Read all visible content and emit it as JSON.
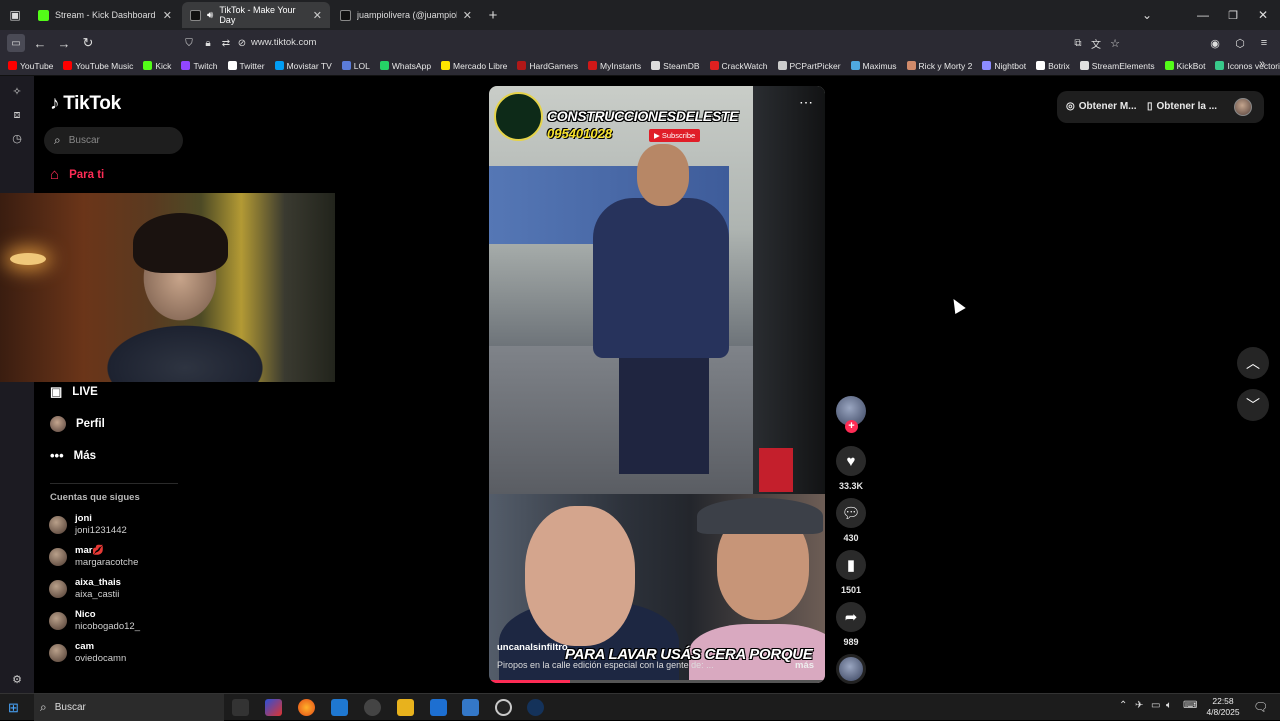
{
  "browser": {
    "tabs": [
      {
        "title": "Stream - Kick Dashboard",
        "icon": "kick-icon",
        "color": "#53fc18"
      },
      {
        "title": "TikTok - Make Your Day",
        "icon": "tiktok-icon",
        "color": "#ffffff"
      },
      {
        "title": "juampiolivera (@juampiolivera_",
        "icon": "tiktok-icon",
        "color": "#ffffff"
      }
    ],
    "new_tab": "+",
    "url": "www.tiktok.com",
    "bookmarks": [
      {
        "label": "YouTube",
        "color": "#ff0000"
      },
      {
        "label": "YouTube Music",
        "color": "#ff0000"
      },
      {
        "label": "Kick",
        "color": "#53fc18"
      },
      {
        "label": "Twitch",
        "color": "#9146ff"
      },
      {
        "label": "Twitter",
        "color": "#ffffff"
      },
      {
        "label": "Movistar TV",
        "color": "#019df4"
      },
      {
        "label": "LOL",
        "color": "#5b7cd8"
      },
      {
        "label": "WhatsApp",
        "color": "#25d366"
      },
      {
        "label": "Mercado Libre",
        "color": "#ffe600"
      },
      {
        "label": "HardGamers",
        "color": "#b01818"
      },
      {
        "label": "MyInstants",
        "color": "#d01818"
      },
      {
        "label": "SteamDB",
        "color": "#dddddd"
      },
      {
        "label": "CrackWatch",
        "color": "#e02020"
      },
      {
        "label": "PCPartPicker",
        "color": "#cccccc"
      },
      {
        "label": "Maximus",
        "color": "#4fa8e0"
      },
      {
        "label": "Rick y Morty 2",
        "color": "#d08a6a"
      },
      {
        "label": "Nightbot",
        "color": "#8c8cff"
      },
      {
        "label": "Botrix",
        "color": "#ffffff"
      },
      {
        "label": "StreamElements",
        "color": "#e0e0e0"
      },
      {
        "label": "KickBot",
        "color": "#53fc18"
      },
      {
        "label": "Iconos vectoriales y sti...",
        "color": "#38c98b"
      }
    ]
  },
  "tiktok": {
    "logo": "TikTok",
    "search_placeholder": "Buscar",
    "nav": {
      "para_ti": "Para ti",
      "live": "LIVE",
      "perfil": "Perfil",
      "mas": "Más"
    },
    "following_title": "Cuentas que sigues",
    "following": [
      {
        "name": "joni",
        "handle": "joni1231442"
      },
      {
        "name": "mar💋",
        "handle": "margaracotche"
      },
      {
        "name": "aixa_thais",
        "handle": "aixa_castii"
      },
      {
        "name": "Nico",
        "handle": "nicobogado12_"
      },
      {
        "name": "cam",
        "handle": "oviedocamn"
      }
    ],
    "get_app_1": "Obtener M...",
    "get_app_2": "Obtener la ...",
    "video": {
      "brand_overlay": "CONSTRUCCIONESDELESTE",
      "phone_overlay": "095401028",
      "subscribe_label": "Subscribe",
      "caption_overlay": "PARA LAVAR USÁS CERA PORQUE",
      "author": "uncanalsinfiltro",
      "description": "Piropos en la calle edición especial con la gente de: ...",
      "more": "más",
      "progress": 0.24
    },
    "actions": {
      "likes": "33.3K",
      "comments": "430",
      "saves": "1501",
      "shares": "989"
    }
  },
  "taskbar": {
    "search_placeholder": "Buscar",
    "time": "22:58",
    "date": "4/8/2025"
  }
}
